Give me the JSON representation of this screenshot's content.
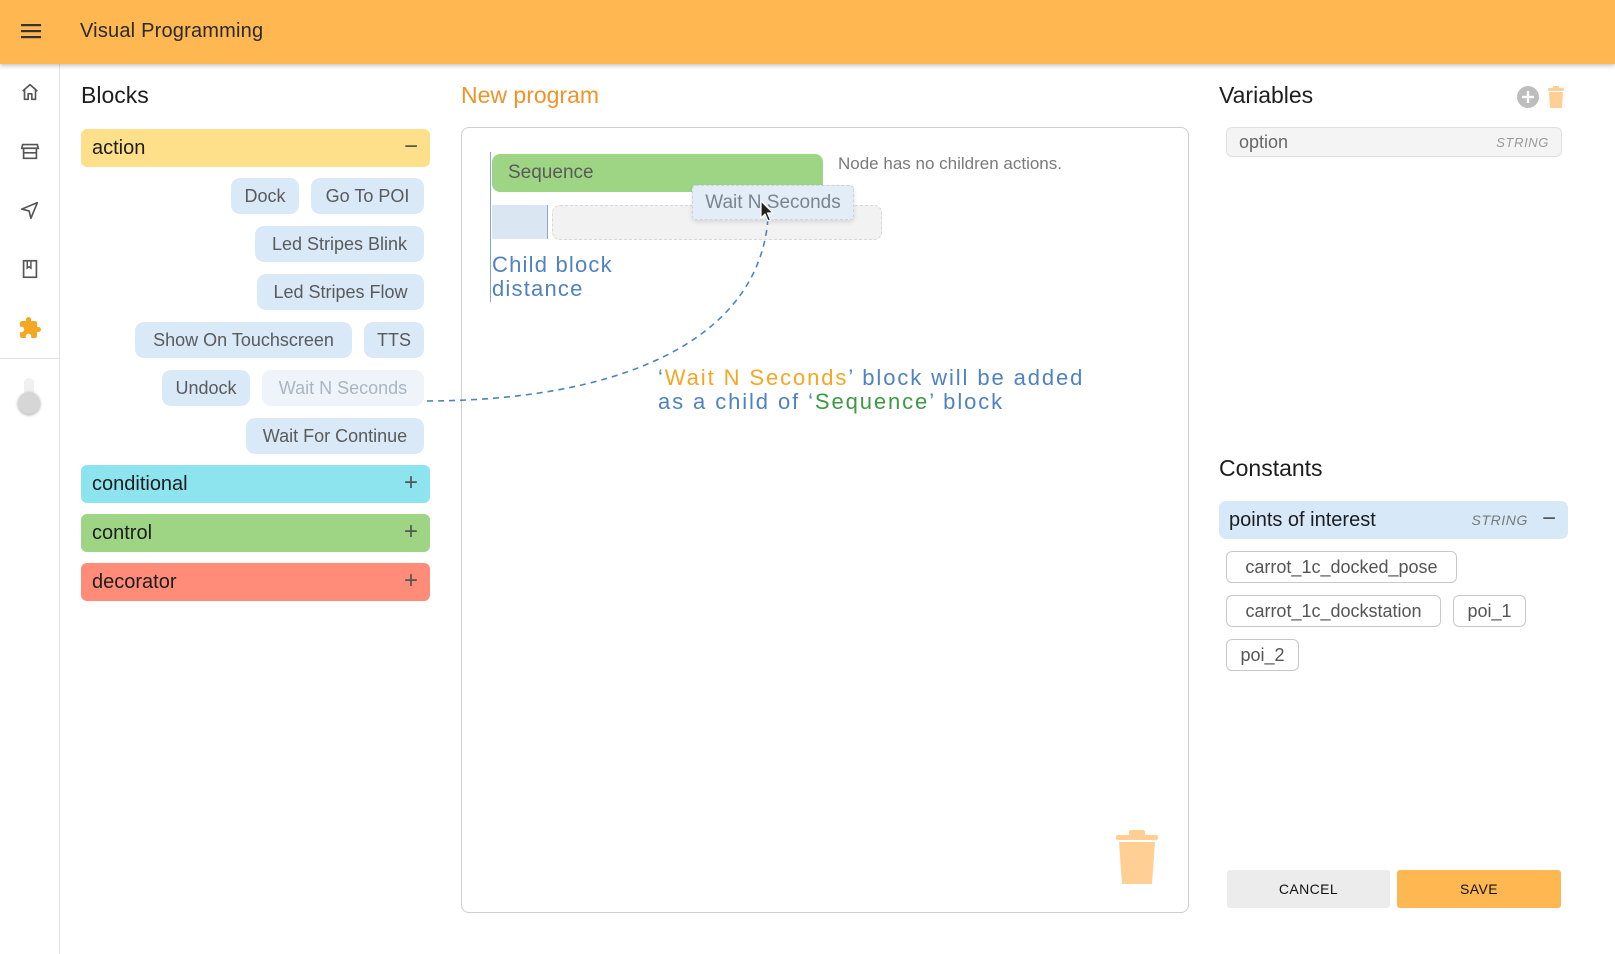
{
  "app": {
    "title": "Visual Programming"
  },
  "nav": {
    "icons": [
      "home-icon",
      "store-icon",
      "send-icon",
      "book-icon",
      "puzzle-icon"
    ]
  },
  "blocks": {
    "title": "Blocks",
    "categories": [
      {
        "label": "action",
        "expanded": true,
        "color": "#ffe08a",
        "toggle": "−"
      },
      {
        "label": "conditional",
        "expanded": false,
        "color": "#8de4ee",
        "toggle": "+"
      },
      {
        "label": "control",
        "expanded": false,
        "color": "#9ed585",
        "toggle": "+"
      },
      {
        "label": "decorator",
        "expanded": false,
        "color": "#ff8c78",
        "toggle": "+"
      }
    ],
    "action_items": [
      "Dock",
      "Go To POI",
      "Led Stripes Blink",
      "Led Stripes Flow",
      "Show On Touchscreen",
      "TTS",
      "Undock",
      "Wait N Seconds",
      "Wait For Continue"
    ]
  },
  "editor": {
    "title": "New program",
    "sequence_label": "Sequence",
    "no_children": "Node has no children actions.",
    "dragging_label": "Wait N Seconds"
  },
  "annotations": {
    "child_distance_1": "Child block",
    "child_distance_2": "distance",
    "msg_q1": "‘",
    "msg_block": "Wait N Seconds",
    "msg_mid": "’ block will be added",
    "msg_line2": "as a child of ‘",
    "msg_seq": "Sequence",
    "msg_end": "’ block"
  },
  "variables": {
    "title": "Variables",
    "items": [
      {
        "name": "option",
        "type": "STRING"
      }
    ]
  },
  "constants": {
    "title": "Constants",
    "group": {
      "name": "points of interest",
      "type": "STRING",
      "toggle": "−"
    },
    "values": [
      "carrot_1c_docked_pose",
      "carrot_1c_dockstation",
      "poi_1",
      "poi_2"
    ]
  },
  "buttons": {
    "cancel": "CANCEL",
    "save": "SAVE"
  },
  "colors": {
    "accent": "#ffb752",
    "title_orange": "#f0932a",
    "annotation_blue": "#4f82c0"
  }
}
